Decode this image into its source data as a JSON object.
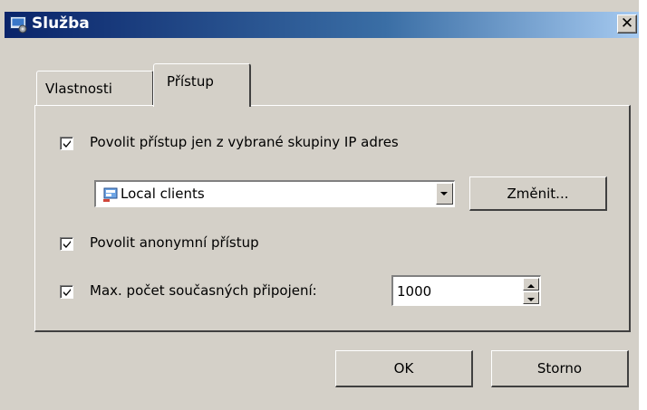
{
  "window": {
    "title": "Služba"
  },
  "tabs": [
    {
      "label": "Vlastnosti",
      "active": false
    },
    {
      "label": "Přístup",
      "active": true
    }
  ],
  "access": {
    "restrict_ip": {
      "label": "Povolit přístup jen z vybrané skupiny IP adres",
      "checked": true
    },
    "ip_group": {
      "value": "Local clients",
      "icon": "network-group-icon"
    },
    "change_button": "Změnit...",
    "anonymous": {
      "label": "Povolit anonymní přístup",
      "checked": true
    },
    "max_connections": {
      "label": "Max. počet současných připojení:",
      "checked": true,
      "value": "1000"
    }
  },
  "footer": {
    "ok_label": "OK",
    "cancel_label": "Storno"
  },
  "colors": {
    "face": "#d4d0c8",
    "title_start": "#0a246a",
    "title_end": "#a6caf0"
  }
}
